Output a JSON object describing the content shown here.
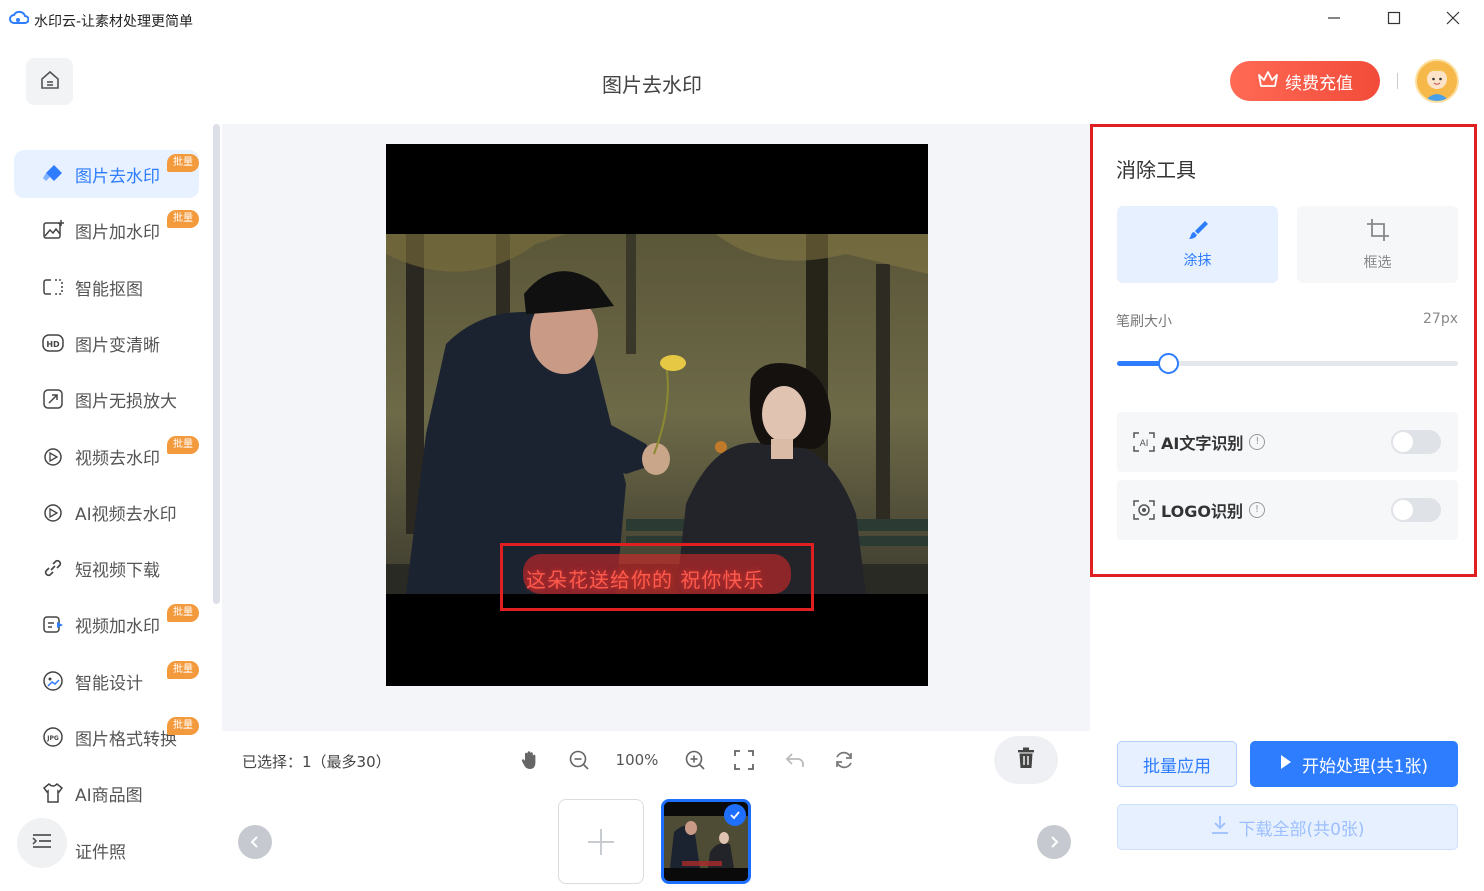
{
  "window": {
    "title": "水印云-让素材处理更简单",
    "minimize_icon": "minimize-icon",
    "maximize_icon": "maximize-icon",
    "close_icon": "close-icon"
  },
  "header": {
    "home_icon": "home-icon",
    "page_title": "图片去水印",
    "recharge_label": "续费充值",
    "recharge_icon": "crown-icon"
  },
  "sidebar": {
    "items": [
      {
        "label": "图片去水印",
        "icon": "eraser-icon",
        "badge": "批量",
        "active": true
      },
      {
        "label": "图片加水印",
        "icon": "image-add-icon",
        "badge": "批量",
        "active": false
      },
      {
        "label": "智能抠图",
        "icon": "cutout-icon",
        "badge": "",
        "active": false
      },
      {
        "label": "图片变清晰",
        "icon": "hd-icon",
        "badge": "",
        "active": false
      },
      {
        "label": "图片无损放大",
        "icon": "enlarge-icon",
        "badge": "",
        "active": false
      },
      {
        "label": "视频去水印",
        "icon": "video-eraser-icon",
        "badge": "批量",
        "active": false
      },
      {
        "label": "AI视频去水印",
        "icon": "ai-video-icon",
        "badge": "",
        "active": false
      },
      {
        "label": "短视频下载",
        "icon": "link-icon",
        "badge": "",
        "active": false
      },
      {
        "label": "视频加水印",
        "icon": "video-add-icon",
        "badge": "批量",
        "active": false
      },
      {
        "label": "智能设计",
        "icon": "design-icon",
        "badge": "批量",
        "active": false
      },
      {
        "label": "图片格式转换",
        "icon": "jpg-icon",
        "badge": "批量",
        "active": false
      },
      {
        "label": "AI商品图",
        "icon": "shirt-icon",
        "badge": "",
        "active": false
      },
      {
        "label": "证件照",
        "icon": "id-photo-icon",
        "badge": "",
        "active": false
      }
    ],
    "collapse_icon": "menu-collapse-icon"
  },
  "canvas": {
    "subtitle_text": "这朵花送给你的 祝你快乐"
  },
  "toolbar": {
    "selection_info": "已选择：1（最多30）",
    "zoom_level": "100%",
    "tools": [
      "hand-icon",
      "zoom-out-icon",
      "zoom-in-icon",
      "fit-screen-icon",
      "undo-icon",
      "reset-icon"
    ],
    "delete_icon": "trash-icon"
  },
  "thumbnails": {
    "add_icon": "plus-icon",
    "selected_count": 1
  },
  "panel": {
    "title": "消除工具",
    "modes": [
      {
        "label": "涂抹",
        "icon": "brush-icon",
        "active": true
      },
      {
        "label": "框选",
        "icon": "crop-icon",
        "active": false
      }
    ],
    "brush_label": "笔刷大小",
    "brush_value": "27px",
    "brush_fraction": 0.15,
    "options": [
      {
        "label": "AI文字识别",
        "icon": "ai-text-icon",
        "enabled": false
      },
      {
        "label": "LOGO识别",
        "icon": "logo-detect-icon",
        "enabled": false
      }
    ],
    "batch_apply_label": "批量应用",
    "start_label": "开始处理(共1张)",
    "download_label": "下载全部(共0张)"
  },
  "colors": {
    "accent": "#2f7dff",
    "recharge": "#f24b3a",
    "badge": "#f39a3d",
    "highlight": "#e02020"
  }
}
